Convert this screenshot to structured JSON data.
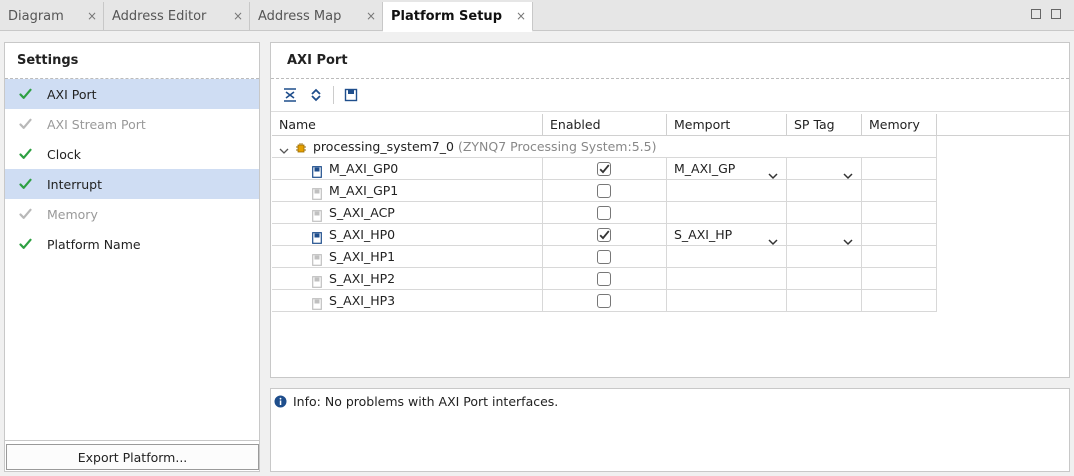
{
  "tabs": [
    {
      "label": "Diagram",
      "active": false
    },
    {
      "label": "Address Editor",
      "active": false
    },
    {
      "label": "Address Map",
      "active": false
    },
    {
      "label": "Platform Setup",
      "active": true
    }
  ],
  "close_glyph": "×",
  "settings": {
    "title": "Settings",
    "items": [
      {
        "label": "AXI Port",
        "enabled": true,
        "selected": true
      },
      {
        "label": "AXI Stream Port",
        "enabled": false,
        "selected": false
      },
      {
        "label": "Clock",
        "enabled": true,
        "selected": false
      },
      {
        "label": "Interrupt",
        "enabled": true,
        "selected": true
      },
      {
        "label": "Memory",
        "enabled": false,
        "selected": false
      },
      {
        "label": "Platform Name",
        "enabled": true,
        "selected": false
      }
    ],
    "export_button": "Export Platform..."
  },
  "axi_port": {
    "title": "AXI Port",
    "columns": [
      "Name",
      "Enabled",
      "Memport",
      "SP Tag",
      "Memory"
    ],
    "parent": {
      "name": "processing_system7_0",
      "detail": "(ZYNQ7 Processing System:5.5)"
    },
    "rows": [
      {
        "name": "M_AXI_GP0",
        "enabled": true,
        "memport": "M_AXI_GP",
        "sptag": ""
      },
      {
        "name": "M_AXI_GP1",
        "enabled": false,
        "memport": "",
        "sptag": ""
      },
      {
        "name": "S_AXI_ACP",
        "enabled": false,
        "memport": "",
        "sptag": ""
      },
      {
        "name": "S_AXI_HP0",
        "enabled": true,
        "memport": "S_AXI_HP",
        "sptag": ""
      },
      {
        "name": "S_AXI_HP1",
        "enabled": false,
        "memport": "",
        "sptag": ""
      },
      {
        "name": "S_AXI_HP2",
        "enabled": false,
        "memport": "",
        "sptag": ""
      },
      {
        "name": "S_AXI_HP3",
        "enabled": false,
        "memport": "",
        "sptag": ""
      }
    ]
  },
  "info": {
    "message": "Info: No problems with AXI Port interfaces."
  },
  "colors": {
    "check_enabled": "#2ea043",
    "check_disabled": "#b8b8b8",
    "selection": "#cfddf3",
    "info_icon": "#1f4e8c"
  }
}
